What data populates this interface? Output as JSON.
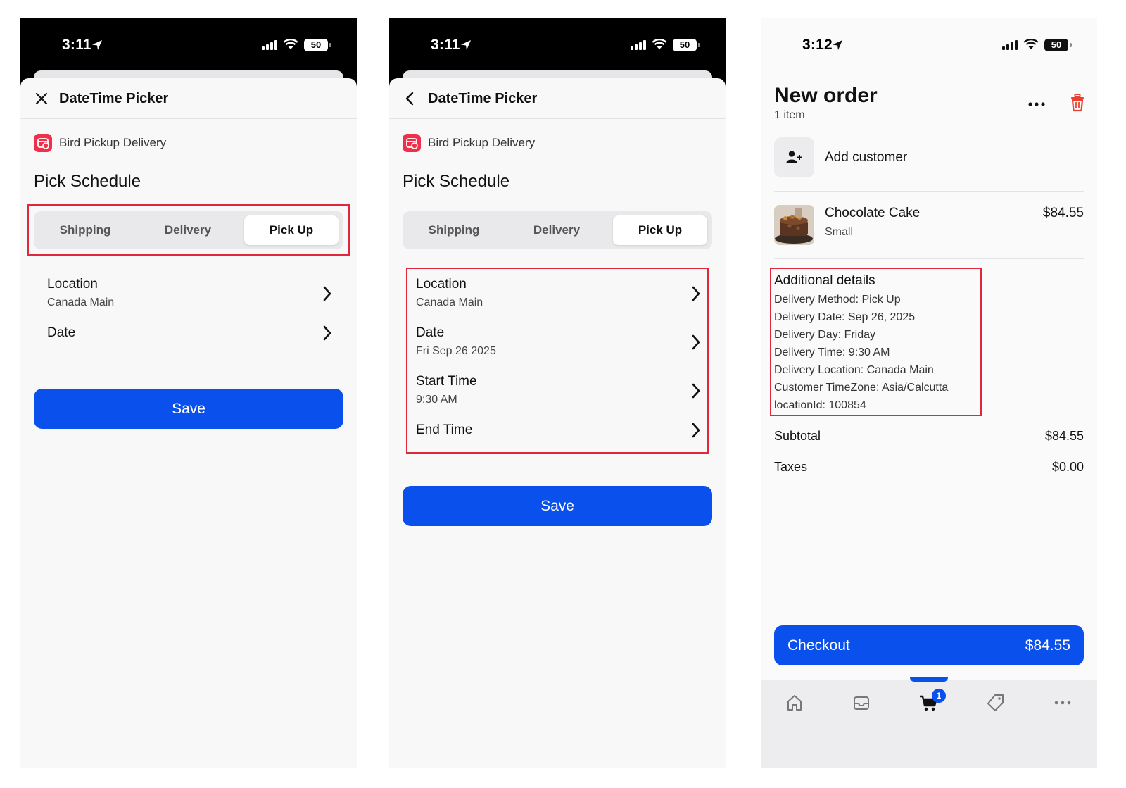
{
  "screens": [
    {
      "status": {
        "time": "3:11",
        "battery": "50"
      },
      "nav_title": "DateTime Picker",
      "app_name": "Bird Pickup Delivery",
      "section_title": "Pick Schedule",
      "tabs": [
        "Shipping",
        "Delivery",
        "Pick Up"
      ],
      "active_tab": "Pick Up",
      "rows": [
        {
          "title": "Location",
          "value": "Canada Main"
        },
        {
          "title": "Date",
          "value": ""
        }
      ],
      "save_label": "Save"
    },
    {
      "status": {
        "time": "3:11",
        "battery": "50"
      },
      "nav_title": "DateTime Picker",
      "app_name": "Bird Pickup Delivery",
      "section_title": "Pick Schedule",
      "tabs": [
        "Shipping",
        "Delivery",
        "Pick Up"
      ],
      "active_tab": "Pick Up",
      "rows": [
        {
          "title": "Location",
          "value": "Canada Main"
        },
        {
          "title": "Date",
          "value": "Fri Sep 26 2025"
        },
        {
          "title": "Start Time",
          "value": "9:30 AM"
        },
        {
          "title": "End Time",
          "value": ""
        }
      ],
      "save_label": "Save"
    },
    {
      "status": {
        "time": "3:12",
        "battery": "50"
      },
      "title": "New order",
      "item_count": "1 item",
      "add_customer": "Add customer",
      "product": {
        "name": "Chocolate Cake",
        "variant": "Small",
        "price": "$84.55"
      },
      "details_title": "Additional details",
      "details": [
        "Delivery Method: Pick Up",
        "Delivery Date: Sep 26, 2025",
        "Delivery Day: Friday",
        "Delivery Time: 9:30 AM",
        "Delivery Location: Canada Main",
        "Customer TimeZone: Asia/Calcutta",
        "locationId: 100854"
      ],
      "subtotal_label": "Subtotal",
      "subtotal": "$84.55",
      "taxes_label": "Taxes",
      "taxes": "$0.00",
      "checkout_label": "Checkout",
      "checkout_total": "$84.55",
      "cart_badge": "1",
      "tab_icons": [
        "home-icon",
        "inbox-icon",
        "cart-icon",
        "tag-icon",
        "more-icon"
      ]
    }
  ],
  "colors": {
    "primary": "#0a50ec",
    "highlight": "#e0283c",
    "app_badge": "#f0304a",
    "trash": "#e8412f"
  }
}
